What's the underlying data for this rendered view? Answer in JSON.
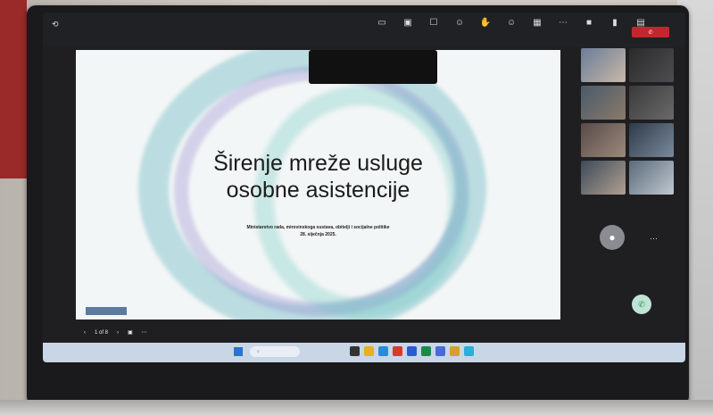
{
  "slide": {
    "title_line1": "Širenje mreže usluge",
    "title_line2": "osobne asistencije",
    "subtitle_line1": "Ministarstvo rada, mirovinskoga sustava, obitelji i socijalne politike",
    "subtitle_line2": "28. siječnja 2025."
  },
  "slide_nav": {
    "counter": "1 of 8"
  },
  "icons": [
    "back-arrow-icon",
    "share-screen-icon",
    "more-icon",
    "phone-icon",
    "windows-start-icon",
    "search-icon"
  ],
  "colors": {
    "leave": "#c4262e",
    "taskbar": "#c9d6e6",
    "slide_bg": "#f3f6f6"
  }
}
